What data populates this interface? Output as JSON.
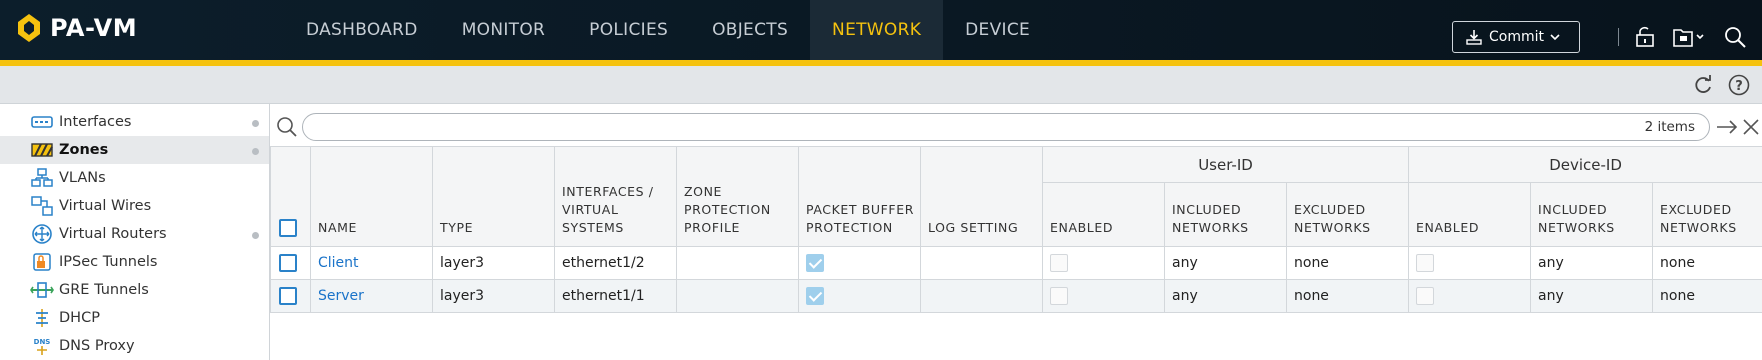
{
  "app": {
    "name": "PA-VM"
  },
  "nav": {
    "tabs": [
      {
        "label": "DASHBOARD"
      },
      {
        "label": "MONITOR"
      },
      {
        "label": "POLICIES"
      },
      {
        "label": "OBJECTS"
      },
      {
        "label": "NETWORK",
        "active": true
      },
      {
        "label": "DEVICE"
      }
    ]
  },
  "toolbar": {
    "commit_label": "Commit"
  },
  "icons": {
    "lock": "lock-icon",
    "config": "config-icon",
    "search": "search-icon",
    "refresh": "refresh-icon",
    "help": "help-icon"
  },
  "colors": {
    "accent": "#f5c20f",
    "header_bg": "#0c1e2b",
    "link": "#1a73c9",
    "check": "#2a82c9"
  },
  "sidebar": {
    "items": [
      {
        "label": "Interfaces",
        "dot": true
      },
      {
        "label": "Zones",
        "dot": true,
        "active": true
      },
      {
        "label": "VLANs"
      },
      {
        "label": "Virtual Wires"
      },
      {
        "label": "Virtual Routers",
        "dot": true
      },
      {
        "label": "IPSec Tunnels"
      },
      {
        "label": "GRE Tunnels"
      },
      {
        "label": "DHCP"
      },
      {
        "label": "DNS Proxy"
      }
    ]
  },
  "search": {
    "placeholder": "",
    "items_count": "2 items"
  },
  "table": {
    "groups": {
      "user_id": "User-ID",
      "device_id": "Device-ID"
    },
    "headers": {
      "name": "NAME",
      "type": "TYPE",
      "interfaces": "INTERFACES / VIRTUAL SYSTEMS",
      "zone_protection": "ZONE PROTECTION PROFILE",
      "packet_buffer": "PACKET BUFFER PROTECTION",
      "log_setting": "LOG SETTING",
      "uid_enabled": "ENABLED",
      "uid_included": "INCLUDED NETWORKS",
      "uid_excluded": "EXCLUDED NETWORKS",
      "did_enabled": "ENABLED",
      "did_included": "INCLUDED NETWORKS",
      "did_excluded": "EXCLUDED NETWORKS"
    },
    "rows": [
      {
        "name": "Client",
        "type": "layer3",
        "interfaces": "ethernet1/2",
        "zone_protection": "",
        "packet_buffer": true,
        "log_setting": "",
        "uid_enabled": false,
        "uid_included": "any",
        "uid_excluded": "none",
        "did_enabled": false,
        "did_included": "any",
        "did_excluded": "none"
      },
      {
        "name": "Server",
        "type": "layer3",
        "interfaces": "ethernet1/1",
        "zone_protection": "",
        "packet_buffer": true,
        "log_setting": "",
        "uid_enabled": false,
        "uid_included": "any",
        "uid_excluded": "none",
        "did_enabled": false,
        "did_included": "any",
        "did_excluded": "none"
      }
    ]
  }
}
